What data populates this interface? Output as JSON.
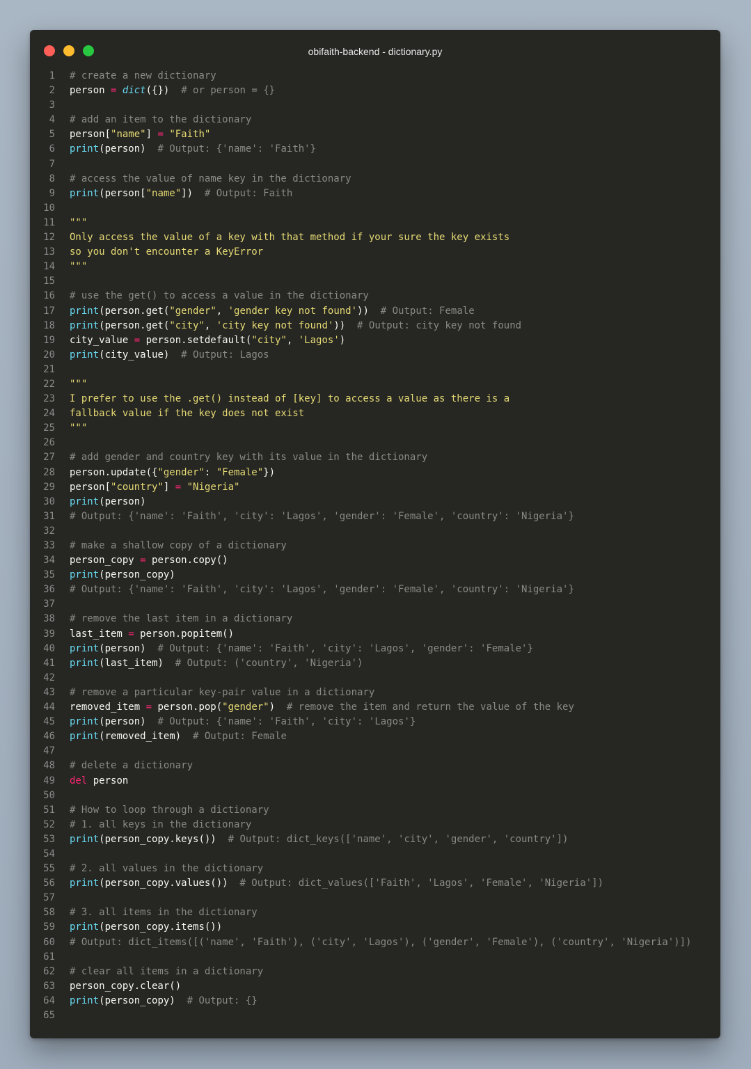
{
  "window": {
    "title": "obifaith-backend - dictionary.py",
    "traffic_lights": {
      "close": "#fe5f57",
      "minimize": "#febc2e",
      "zoom": "#28c840"
    }
  },
  "theme": {
    "background": "#262623",
    "comment": "#8a8a84",
    "builtin": "#67d8ef",
    "string": "#e6db74",
    "operator": "#f92672",
    "text": "#f8f8f2"
  },
  "code": [
    {
      "n": "1",
      "t": [
        [
          "cmt",
          "# create a new dictionary"
        ]
      ]
    },
    {
      "n": "2",
      "t": [
        [
          "txt",
          "person "
        ],
        [
          "op",
          "="
        ],
        [
          "txt",
          " "
        ],
        [
          "ital",
          "dict"
        ],
        [
          "txt",
          "({})  "
        ],
        [
          "cmt",
          "# or person = {}"
        ]
      ]
    },
    {
      "n": "3",
      "t": []
    },
    {
      "n": "4",
      "t": [
        [
          "cmt",
          "# add an item to the dictionary"
        ]
      ]
    },
    {
      "n": "5",
      "t": [
        [
          "txt",
          "person["
        ],
        [
          "str",
          "\"name\""
        ],
        [
          "txt",
          "] "
        ],
        [
          "op",
          "="
        ],
        [
          "txt",
          " "
        ],
        [
          "str",
          "\"Faith\""
        ]
      ]
    },
    {
      "n": "6",
      "t": [
        [
          "kw",
          "print"
        ],
        [
          "txt",
          "(person)  "
        ],
        [
          "cmt",
          "# Output: {'name': 'Faith'}"
        ]
      ]
    },
    {
      "n": "7",
      "t": []
    },
    {
      "n": "8",
      "t": [
        [
          "cmt",
          "# access the value of name key in the dictionary"
        ]
      ]
    },
    {
      "n": "9",
      "t": [
        [
          "kw",
          "print"
        ],
        [
          "txt",
          "(person["
        ],
        [
          "str",
          "\"name\""
        ],
        [
          "txt",
          "])  "
        ],
        [
          "cmt",
          "# Output: Faith"
        ]
      ]
    },
    {
      "n": "10",
      "t": []
    },
    {
      "n": "11",
      "t": [
        [
          "doc",
          "\"\"\""
        ]
      ]
    },
    {
      "n": "12",
      "t": [
        [
          "doc",
          "Only access the value of a key with that method if your sure the key exists"
        ]
      ]
    },
    {
      "n": "13",
      "t": [
        [
          "doc",
          "so you don't encounter a KeyError"
        ]
      ]
    },
    {
      "n": "14",
      "t": [
        [
          "doc",
          "\"\"\""
        ]
      ]
    },
    {
      "n": "15",
      "t": []
    },
    {
      "n": "16",
      "t": [
        [
          "cmt",
          "# use the get() to access a value in the dictionary"
        ]
      ]
    },
    {
      "n": "17",
      "t": [
        [
          "kw",
          "print"
        ],
        [
          "txt",
          "(person.get("
        ],
        [
          "str",
          "\"gender\""
        ],
        [
          "txt",
          ", "
        ],
        [
          "str",
          "'gender key not found'"
        ],
        [
          "txt",
          "))  "
        ],
        [
          "cmt",
          "# Output: Female"
        ]
      ]
    },
    {
      "n": "18",
      "t": [
        [
          "kw",
          "print"
        ],
        [
          "txt",
          "(person.get("
        ],
        [
          "str",
          "\"city\""
        ],
        [
          "txt",
          ", "
        ],
        [
          "str",
          "'city key not found'"
        ],
        [
          "txt",
          "))  "
        ],
        [
          "cmt",
          "# Output: city key not found"
        ]
      ]
    },
    {
      "n": "19",
      "t": [
        [
          "txt",
          "city_value "
        ],
        [
          "op",
          "="
        ],
        [
          "txt",
          " person.setdefault("
        ],
        [
          "str",
          "\"city\""
        ],
        [
          "txt",
          ", "
        ],
        [
          "str",
          "'Lagos'"
        ],
        [
          "txt",
          ")"
        ]
      ]
    },
    {
      "n": "20",
      "t": [
        [
          "kw",
          "print"
        ],
        [
          "txt",
          "(city_value)  "
        ],
        [
          "cmt",
          "# Output: Lagos"
        ]
      ]
    },
    {
      "n": "21",
      "t": []
    },
    {
      "n": "22",
      "t": [
        [
          "doc",
          "\"\"\""
        ]
      ]
    },
    {
      "n": "23",
      "t": [
        [
          "doc",
          "I prefer to use the .get() instead of [key] to access a value as there is a"
        ]
      ]
    },
    {
      "n": "24",
      "t": [
        [
          "doc",
          "fallback value if the key does not exist"
        ]
      ]
    },
    {
      "n": "25",
      "t": [
        [
          "doc",
          "\"\"\""
        ]
      ]
    },
    {
      "n": "26",
      "t": []
    },
    {
      "n": "27",
      "t": [
        [
          "cmt",
          "# add gender and country key with its value in the dictionary"
        ]
      ]
    },
    {
      "n": "28",
      "t": [
        [
          "txt",
          "person.update({"
        ],
        [
          "str",
          "\"gender\""
        ],
        [
          "txt",
          ": "
        ],
        [
          "str",
          "\"Female\""
        ],
        [
          "txt",
          "})"
        ]
      ]
    },
    {
      "n": "29",
      "t": [
        [
          "txt",
          "person["
        ],
        [
          "str",
          "\"country\""
        ],
        [
          "txt",
          "] "
        ],
        [
          "op",
          "="
        ],
        [
          "txt",
          " "
        ],
        [
          "str",
          "\"Nigeria\""
        ]
      ]
    },
    {
      "n": "30",
      "t": [
        [
          "kw",
          "print"
        ],
        [
          "txt",
          "(person)"
        ]
      ]
    },
    {
      "n": "31",
      "t": [
        [
          "cmt",
          "# Output: {'name': 'Faith', 'city': 'Lagos', 'gender': 'Female', 'country': 'Nigeria'}"
        ]
      ]
    },
    {
      "n": "32",
      "t": []
    },
    {
      "n": "33",
      "t": [
        [
          "cmt",
          "# make a shallow copy of a dictionary"
        ]
      ]
    },
    {
      "n": "34",
      "t": [
        [
          "txt",
          "person_copy "
        ],
        [
          "op",
          "="
        ],
        [
          "txt",
          " person.copy()"
        ]
      ]
    },
    {
      "n": "35",
      "t": [
        [
          "kw",
          "print"
        ],
        [
          "txt",
          "(person_copy)"
        ]
      ]
    },
    {
      "n": "36",
      "t": [
        [
          "cmt",
          "# Output: {'name': 'Faith', 'city': 'Lagos', 'gender': 'Female', 'country': 'Nigeria'}"
        ]
      ]
    },
    {
      "n": "37",
      "t": []
    },
    {
      "n": "38",
      "t": [
        [
          "cmt",
          "# remove the last item in a dictionary"
        ]
      ]
    },
    {
      "n": "39",
      "t": [
        [
          "txt",
          "last_item "
        ],
        [
          "op",
          "="
        ],
        [
          "txt",
          " person.popitem()"
        ]
      ]
    },
    {
      "n": "40",
      "t": [
        [
          "kw",
          "print"
        ],
        [
          "txt",
          "(person)  "
        ],
        [
          "cmt",
          "# Output: {'name': 'Faith', 'city': 'Lagos', 'gender': 'Female'}"
        ]
      ]
    },
    {
      "n": "41",
      "t": [
        [
          "kw",
          "print"
        ],
        [
          "txt",
          "(last_item)  "
        ],
        [
          "cmt",
          "# Output: ('country', 'Nigeria')"
        ]
      ]
    },
    {
      "n": "42",
      "t": []
    },
    {
      "n": "43",
      "t": [
        [
          "cmt",
          "# remove a particular key-pair value in a dictionary"
        ]
      ]
    },
    {
      "n": "44",
      "t": [
        [
          "txt",
          "removed_item "
        ],
        [
          "op",
          "="
        ],
        [
          "txt",
          " person.pop("
        ],
        [
          "str",
          "\"gender\""
        ],
        [
          "txt",
          ")  "
        ],
        [
          "cmt",
          "# remove the item and return the value of the key"
        ]
      ]
    },
    {
      "n": "45",
      "t": [
        [
          "kw",
          "print"
        ],
        [
          "txt",
          "(person)  "
        ],
        [
          "cmt",
          "# Output: {'name': 'Faith', 'city': 'Lagos'}"
        ]
      ]
    },
    {
      "n": "46",
      "t": [
        [
          "kw",
          "print"
        ],
        [
          "txt",
          "(removed_item)  "
        ],
        [
          "cmt",
          "# Output: Female"
        ]
      ]
    },
    {
      "n": "47",
      "t": []
    },
    {
      "n": "48",
      "t": [
        [
          "cmt",
          "# delete a dictionary"
        ]
      ]
    },
    {
      "n": "49",
      "t": [
        [
          "del",
          "del"
        ],
        [
          "txt",
          " person"
        ]
      ]
    },
    {
      "n": "50",
      "t": []
    },
    {
      "n": "51",
      "t": [
        [
          "cmt",
          "# How to loop through a dictionary"
        ]
      ]
    },
    {
      "n": "52",
      "t": [
        [
          "cmt",
          "# 1. all keys in the dictionary"
        ]
      ]
    },
    {
      "n": "53",
      "t": [
        [
          "kw",
          "print"
        ],
        [
          "txt",
          "(person_copy.keys())  "
        ],
        [
          "cmt",
          "# Output: dict_keys(['name', 'city', 'gender', 'country'])"
        ]
      ]
    },
    {
      "n": "54",
      "t": []
    },
    {
      "n": "55",
      "t": [
        [
          "cmt",
          "# 2. all values in the dictionary"
        ]
      ]
    },
    {
      "n": "56",
      "t": [
        [
          "kw",
          "print"
        ],
        [
          "txt",
          "(person_copy.values())  "
        ],
        [
          "cmt",
          "# Output: dict_values(['Faith', 'Lagos', 'Female', 'Nigeria'])"
        ]
      ]
    },
    {
      "n": "57",
      "t": []
    },
    {
      "n": "58",
      "t": [
        [
          "cmt",
          "# 3. all items in the dictionary"
        ]
      ]
    },
    {
      "n": "59",
      "t": [
        [
          "kw",
          "print"
        ],
        [
          "txt",
          "(person_copy.items())"
        ]
      ]
    },
    {
      "n": "60",
      "t": [
        [
          "cmt",
          "# Output: dict_items([('name', 'Faith'), ('city', 'Lagos'), ('gender', 'Female'), ('country', 'Nigeria')])"
        ]
      ]
    },
    {
      "n": "61",
      "t": []
    },
    {
      "n": "62",
      "t": [
        [
          "cmt",
          "# clear all items in a dictionary"
        ]
      ]
    },
    {
      "n": "63",
      "t": [
        [
          "txt",
          "person_copy.clear()"
        ]
      ]
    },
    {
      "n": "64",
      "t": [
        [
          "kw",
          "print"
        ],
        [
          "txt",
          "(person_copy)  "
        ],
        [
          "cmt",
          "# Output: {}"
        ]
      ]
    },
    {
      "n": "65",
      "t": []
    }
  ]
}
